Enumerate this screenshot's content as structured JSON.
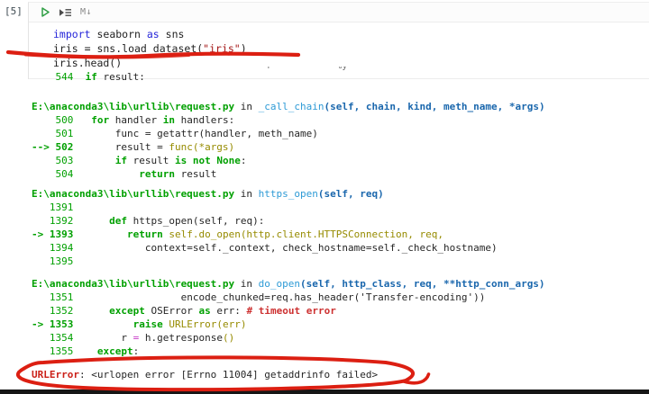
{
  "colors": {
    "annotation_red": "#dc1f12",
    "bottom_bar": "#161616",
    "traceback_green": "#00a000",
    "traceback_fn_blue": "#2e9bd6",
    "traceback_sig_blue": "#1a67ad",
    "traceback_olive": "#968b00",
    "error_red": "#cb2018",
    "keyword_blue": "#2626d9",
    "string_red": "#a31515"
  },
  "cell": {
    "execution_count": "[5]",
    "toolbar": {
      "run_icon": "play-triangle-outline",
      "run_below_icon": "triangle-with-lines",
      "markdown_label": "M↓"
    },
    "code_lines": [
      {
        "segs": [
          [
            "import",
            "ck"
          ],
          [
            " seaborn ",
            "cd"
          ],
          [
            "as",
            "ck"
          ],
          [
            " sns",
            "cd"
          ]
        ]
      },
      {
        "segs": [
          [
            "iris = sns.load_dataset(",
            "cd"
          ],
          [
            "\"iris\"",
            "cs"
          ],
          [
            ")",
            "cd"
          ]
        ]
      },
      {
        "segs": [
          [
            "iris.head()",
            "cd"
          ]
        ]
      }
    ]
  },
  "output": {
    "clipped_fragment": "-'f''' ~  ' ' '%y",
    "lines": [
      {
        "segs": [
          [
            "    ",
            "d"
          ],
          [
            "544",
            "num"
          ],
          [
            "  ",
            "d"
          ],
          [
            "if",
            "kw"
          ],
          [
            " result:",
            "d"
          ]
        ]
      },
      {
        "mt": 18,
        "segs": [
          [
            "E:\\anaconda3\\lib\\urllib\\request.py",
            "path"
          ],
          [
            " in ",
            "d"
          ],
          [
            "_call_chain",
            "fn"
          ],
          [
            "(self, chain, kind, meth_name, *args)",
            "sig"
          ]
        ]
      },
      {
        "segs": [
          [
            "    ",
            "d"
          ],
          [
            "500",
            "num"
          ],
          [
            "   ",
            "d"
          ],
          [
            "for",
            "kw"
          ],
          [
            " handler ",
            "d"
          ],
          [
            "in",
            "kw"
          ],
          [
            " handlers:",
            "d"
          ]
        ]
      },
      {
        "segs": [
          [
            "    ",
            "d"
          ],
          [
            "501",
            "num"
          ],
          [
            "       ",
            "d"
          ],
          [
            "func = getattr(handler, meth_name)",
            "d"
          ]
        ]
      },
      {
        "segs": [
          [
            "--> 502",
            "arrow"
          ],
          [
            "       ",
            "d"
          ],
          [
            "result = ",
            "d"
          ],
          [
            "func(*args)",
            "o"
          ]
        ]
      },
      {
        "segs": [
          [
            "    ",
            "d"
          ],
          [
            "503",
            "num"
          ],
          [
            "       ",
            "d"
          ],
          [
            "if",
            "kw"
          ],
          [
            " result ",
            "d"
          ],
          [
            "is",
            "kw"
          ],
          [
            " ",
            "d"
          ],
          [
            "not",
            "kw"
          ],
          [
            " ",
            "d"
          ],
          [
            "None",
            "kw"
          ],
          [
            ":",
            "d"
          ]
        ]
      },
      {
        "segs": [
          [
            "    ",
            "d"
          ],
          [
            "504",
            "num"
          ],
          [
            "           ",
            "d"
          ],
          [
            "return",
            "kw"
          ],
          [
            " result",
            "d"
          ]
        ]
      },
      {
        "mt": 7,
        "segs": [
          [
            "E:\\anaconda3\\lib\\urllib\\request.py",
            "path"
          ],
          [
            " in ",
            "d"
          ],
          [
            "https_open",
            "fn"
          ],
          [
            "(self, req)",
            "sig"
          ]
        ]
      },
      {
        "segs": [
          [
            "   ",
            "d"
          ],
          [
            "1391",
            "num"
          ]
        ]
      },
      {
        "segs": [
          [
            "   ",
            "d"
          ],
          [
            "1392",
            "num"
          ],
          [
            "      ",
            "d"
          ],
          [
            "def",
            "kw"
          ],
          [
            " https_open(self, req):",
            "d"
          ]
        ]
      },
      {
        "segs": [
          [
            "-> 1393",
            "arrow"
          ],
          [
            "         ",
            "d"
          ],
          [
            "return",
            "kw"
          ],
          [
            " ",
            "d"
          ],
          [
            "self.do_open(http.client.HTTPSConnection, req,",
            "o"
          ]
        ]
      },
      {
        "segs": [
          [
            "   ",
            "d"
          ],
          [
            "1394",
            "num"
          ],
          [
            "            ",
            "d"
          ],
          [
            "context=self._context, check_hostname=self._check_hostname)",
            "d"
          ]
        ]
      },
      {
        "segs": [
          [
            "   ",
            "d"
          ],
          [
            "1395",
            "num"
          ]
        ]
      },
      {
        "mt": 10,
        "segs": [
          [
            "E:\\anaconda3\\lib\\urllib\\request.py",
            "path"
          ],
          [
            " in ",
            "d"
          ],
          [
            "do_open",
            "fn"
          ],
          [
            "(self, http_class, req, **http_conn_args)",
            "sig"
          ]
        ]
      },
      {
        "segs": [
          [
            "   ",
            "d"
          ],
          [
            "1351",
            "num"
          ],
          [
            "                  ",
            "d"
          ],
          [
            "encode_chunked=req.has_header('Transfer-encoding'))",
            "d"
          ]
        ]
      },
      {
        "segs": [
          [
            "   ",
            "d"
          ],
          [
            "1352",
            "num"
          ],
          [
            "      ",
            "d"
          ],
          [
            "except",
            "kw"
          ],
          [
            " OSError ",
            "d"
          ],
          [
            "as",
            "kw"
          ],
          [
            " err: ",
            "d"
          ],
          [
            "# timeout error",
            "cm"
          ]
        ]
      },
      {
        "segs": [
          [
            "-> 1353",
            "arrow"
          ],
          [
            "          ",
            "d"
          ],
          [
            "raise",
            "kw"
          ],
          [
            " ",
            "d"
          ],
          [
            "URLError(err)",
            "o"
          ]
        ]
      },
      {
        "segs": [
          [
            "   ",
            "d"
          ],
          [
            "1354",
            "num"
          ],
          [
            "        ",
            "d"
          ],
          [
            "r ",
            "d"
          ],
          [
            "=",
            "pk"
          ],
          [
            " h.getresponse",
            "d"
          ],
          [
            "()",
            "o"
          ]
        ]
      },
      {
        "segs": [
          [
            "   ",
            "d"
          ],
          [
            "1355",
            "num"
          ],
          [
            "    ",
            "d"
          ],
          [
            "except",
            "kw"
          ],
          [
            ":",
            "d"
          ]
        ]
      },
      {
        "mt": 11,
        "name": "error-line",
        "segs": [
          [
            "URLError",
            "err"
          ],
          [
            ": <urlopen error [Errno 11004] getaddrinfo failed>",
            "d"
          ]
        ]
      }
    ]
  }
}
